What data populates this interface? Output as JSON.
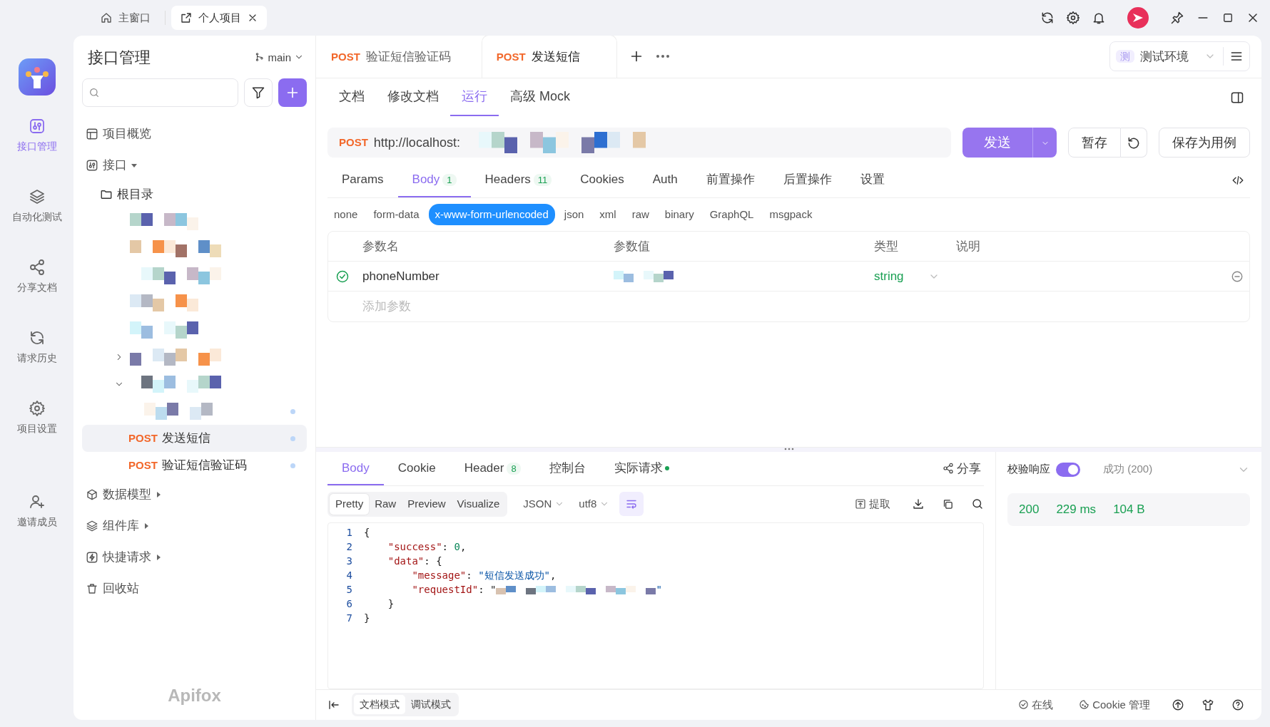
{
  "title_bar": {
    "tabs": [
      {
        "label": "主窗口",
        "selected": false
      },
      {
        "label": "个人项目",
        "selected": true
      }
    ]
  },
  "rail": {
    "items": [
      {
        "label": "接口管理",
        "selected": true
      },
      {
        "label": "自动化测试",
        "selected": false
      },
      {
        "label": "分享文档",
        "selected": false
      },
      {
        "label": "请求历史",
        "selected": false
      },
      {
        "label": "项目设置",
        "selected": false
      },
      {
        "label": "邀请成员",
        "selected": false
      }
    ]
  },
  "sidebar": {
    "title": "接口管理",
    "branch": "main",
    "brand": "Apifox",
    "tree": [
      {
        "kind": "section",
        "label": "项目概览"
      },
      {
        "kind": "group",
        "label": "接口",
        "expanded": true,
        "children": [
          {
            "kind": "folder",
            "label": "根目录",
            "children": [
              {
                "kind": "redacted",
                "dot": false
              },
              {
                "kind": "redacted",
                "dot": false
              },
              {
                "kind": "redacted",
                "dot": false
              },
              {
                "kind": "redacted",
                "dot": false
              },
              {
                "kind": "redacted",
                "dot": false
              },
              {
                "kind": "redacted_folder",
                "expanded": false
              },
              {
                "kind": "redacted_folder",
                "expanded": true,
                "children": [
                  {
                    "kind": "redacted",
                    "dot": true
                  },
                  {
                    "kind": "endpoint",
                    "method": "POST",
                    "label": "发送短信",
                    "selected": true,
                    "dot": true
                  },
                  {
                    "kind": "endpoint",
                    "method": "POST",
                    "label": "验证短信验证码",
                    "selected": false,
                    "dot": true
                  }
                ]
              }
            ]
          }
        ]
      },
      {
        "kind": "group",
        "label": "数据模型",
        "expanded": false
      },
      {
        "kind": "group",
        "label": "组件库",
        "expanded": false
      },
      {
        "kind": "group",
        "label": "快捷请求",
        "expanded": false
      },
      {
        "kind": "section",
        "label": "回收站"
      }
    ]
  },
  "request_tabs": [
    {
      "method": "POST",
      "label": "验证短信验证码",
      "selected": false
    },
    {
      "method": "POST",
      "label": "发送短信",
      "selected": true
    }
  ],
  "environment": {
    "badge": "测",
    "label": "测试环境"
  },
  "sub_tabs": [
    {
      "label": "文档",
      "selected": false
    },
    {
      "label": "修改文档",
      "selected": false
    },
    {
      "label": "运行",
      "selected": true
    },
    {
      "label": "高级 Mock",
      "selected": false
    }
  ],
  "request": {
    "method": "POST",
    "url": "http://localhost:",
    "url_redacted": true,
    "send": "发送",
    "save": "暂存",
    "save_case": "保存为用例"
  },
  "param_tabs": [
    {
      "label": "Params",
      "selected": false
    },
    {
      "label": "Body",
      "count": "1",
      "selected": true
    },
    {
      "label": "Headers",
      "count": "11",
      "selected": false
    },
    {
      "label": "Cookies",
      "selected": false
    },
    {
      "label": "Auth",
      "selected": false
    },
    {
      "label": "前置操作",
      "selected": false
    },
    {
      "label": "后置操作",
      "selected": false
    },
    {
      "label": "设置",
      "selected": false
    }
  ],
  "body_types": [
    {
      "label": "none",
      "selected": false
    },
    {
      "label": "form-data",
      "selected": false
    },
    {
      "label": "x-www-form-urlencoded",
      "selected": true
    },
    {
      "label": "json",
      "selected": false
    },
    {
      "label": "xml",
      "selected": false
    },
    {
      "label": "raw",
      "selected": false
    },
    {
      "label": "binary",
      "selected": false
    },
    {
      "label": "GraphQL",
      "selected": false
    },
    {
      "label": "msgpack",
      "selected": false
    }
  ],
  "params_table": {
    "columns": [
      "参数名",
      "参数值",
      "类型",
      "说明"
    ],
    "rows": [
      {
        "enabled": true,
        "name": "phoneNumber",
        "value_redacted": true,
        "type": "string"
      }
    ],
    "add_placeholder": "添加参数"
  },
  "response": {
    "tabs": [
      {
        "label": "Body",
        "selected": true
      },
      {
        "label": "Cookie",
        "selected": false
      },
      {
        "label": "Header",
        "count": "8",
        "selected": false
      },
      {
        "label": "控制台",
        "selected": false
      },
      {
        "label": "实际请求",
        "dot": true,
        "selected": false
      }
    ],
    "share": "分享",
    "views": [
      {
        "label": "Pretty",
        "selected": true
      },
      {
        "label": "Raw",
        "selected": false
      },
      {
        "label": "Preview",
        "selected": false
      },
      {
        "label": "Visualize",
        "selected": false
      }
    ],
    "format": "JSON",
    "encoding": "utf8",
    "wrap_on": true,
    "extract": "提取",
    "lines": [
      {
        "number": "1",
        "code": "{"
      },
      {
        "number": "2",
        "code": "    \"success\": 0,"
      },
      {
        "number": "3",
        "code": "    \"data\": {"
      },
      {
        "number": "4",
        "code": "        \"message\": \"短信发送成功\","
      },
      {
        "number": "5",
        "code": "        \"requestId\": \"",
        "redacted": true,
        "code_end": "\""
      },
      {
        "number": "6",
        "code": "    }"
      },
      {
        "number": "7",
        "code": "}"
      }
    ],
    "validate": {
      "label": "校验响应",
      "on": true,
      "result": "成功 (200)"
    },
    "stats": [
      "200",
      "229 ms",
      "104 B"
    ]
  },
  "bottom_bar": {
    "modes": [
      {
        "label": "文档模式",
        "selected": true
      },
      {
        "label": "调试模式",
        "selected": false
      }
    ],
    "status": "在线",
    "cookie": "Cookie 管理"
  }
}
